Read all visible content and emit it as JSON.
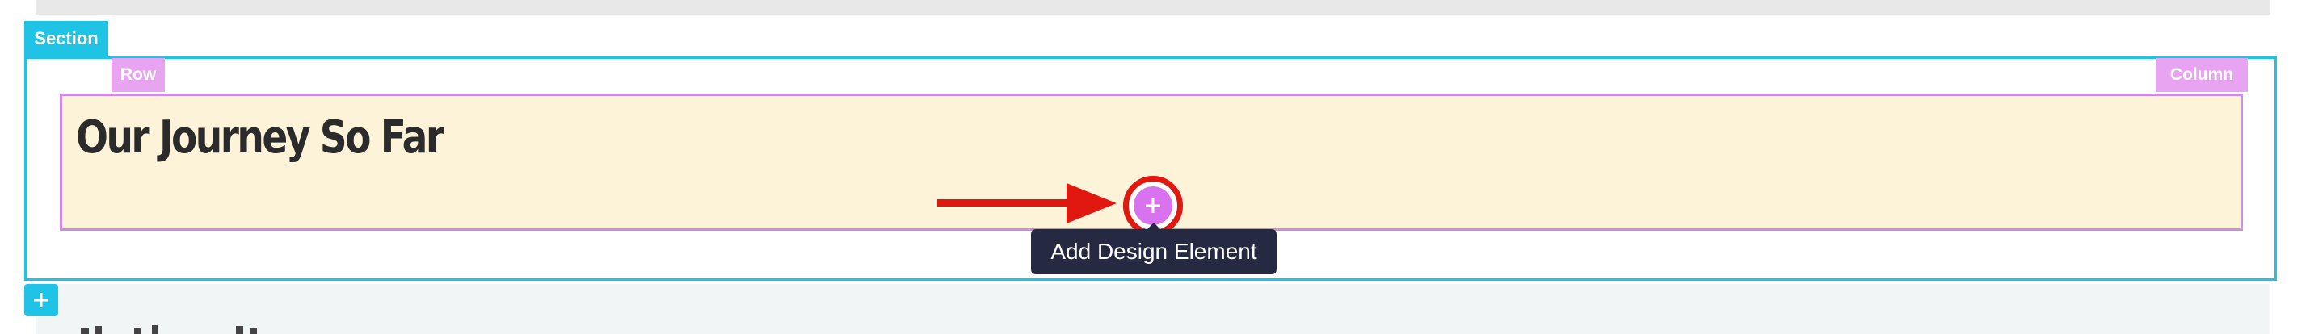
{
  "builder": {
    "section_label": "Section",
    "row_label": "Row",
    "column_label": "Column"
  },
  "content": {
    "heading": "Our Journey So Far"
  },
  "tooltip": {
    "text": "Add Design Element"
  },
  "icons": {
    "add_element": "plus-icon",
    "add_section": "plus-icon",
    "pointer": "arrow-right-icon"
  },
  "colors": {
    "section": "#1fc3e6",
    "row_column": "#e8a4f1",
    "column_background": "#fdf3d8",
    "add_button": "#d872ee",
    "highlight": "#e0180f",
    "tooltip_background": "#252a42"
  }
}
